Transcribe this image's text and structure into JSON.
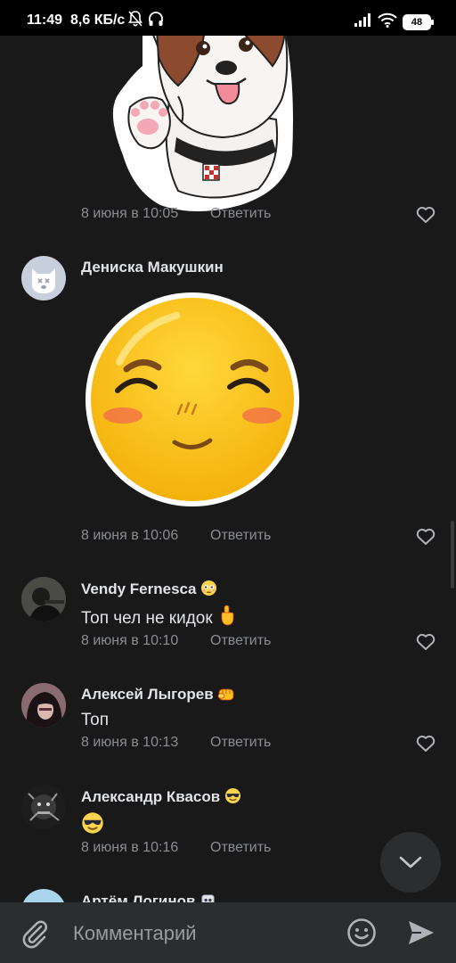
{
  "status_bar": {
    "time": "11:49",
    "speed": "8,6 КБ/с",
    "battery": "48"
  },
  "comments": [
    {
      "author": "",
      "text": "",
      "sticker": "dog-sticker",
      "date": "8 июня в 10:05",
      "reply_label": "Ответить"
    },
    {
      "author": "Дениска Макушкин",
      "text": "",
      "sticker": "smiling-face-sticker",
      "date": "8 июня в 10:06",
      "reply_label": "Ответить"
    },
    {
      "author": "Vendy Fernesca",
      "author_emoji": "flushed-face-emoji",
      "text": "Топ чел не кидок",
      "text_emoji": "pointing-up-emoji",
      "date": "8 июня в 10:10",
      "reply_label": "Ответить"
    },
    {
      "author": "Алексей Лыгорев",
      "author_emoji": "fist-emoji",
      "text": "Топ",
      "date": "8 июня в 10:13",
      "reply_label": "Ответить"
    },
    {
      "author": "Александр Квасов",
      "author_emoji": "sunglasses-emoji",
      "text": "",
      "text_emoji": "sunglasses-emoji",
      "date": "8 июня в 10:16",
      "reply_label": "Ответить"
    },
    {
      "author": "Артём Логинов",
      "author_emoji": "robot-emoji"
    }
  ],
  "composer": {
    "placeholder": "Комментарий"
  },
  "colors": {
    "background": "#19191a",
    "composer_background": "#2c2d2e",
    "primary_text": "#e1e3e6",
    "secondary_text": "#8a8d91"
  }
}
